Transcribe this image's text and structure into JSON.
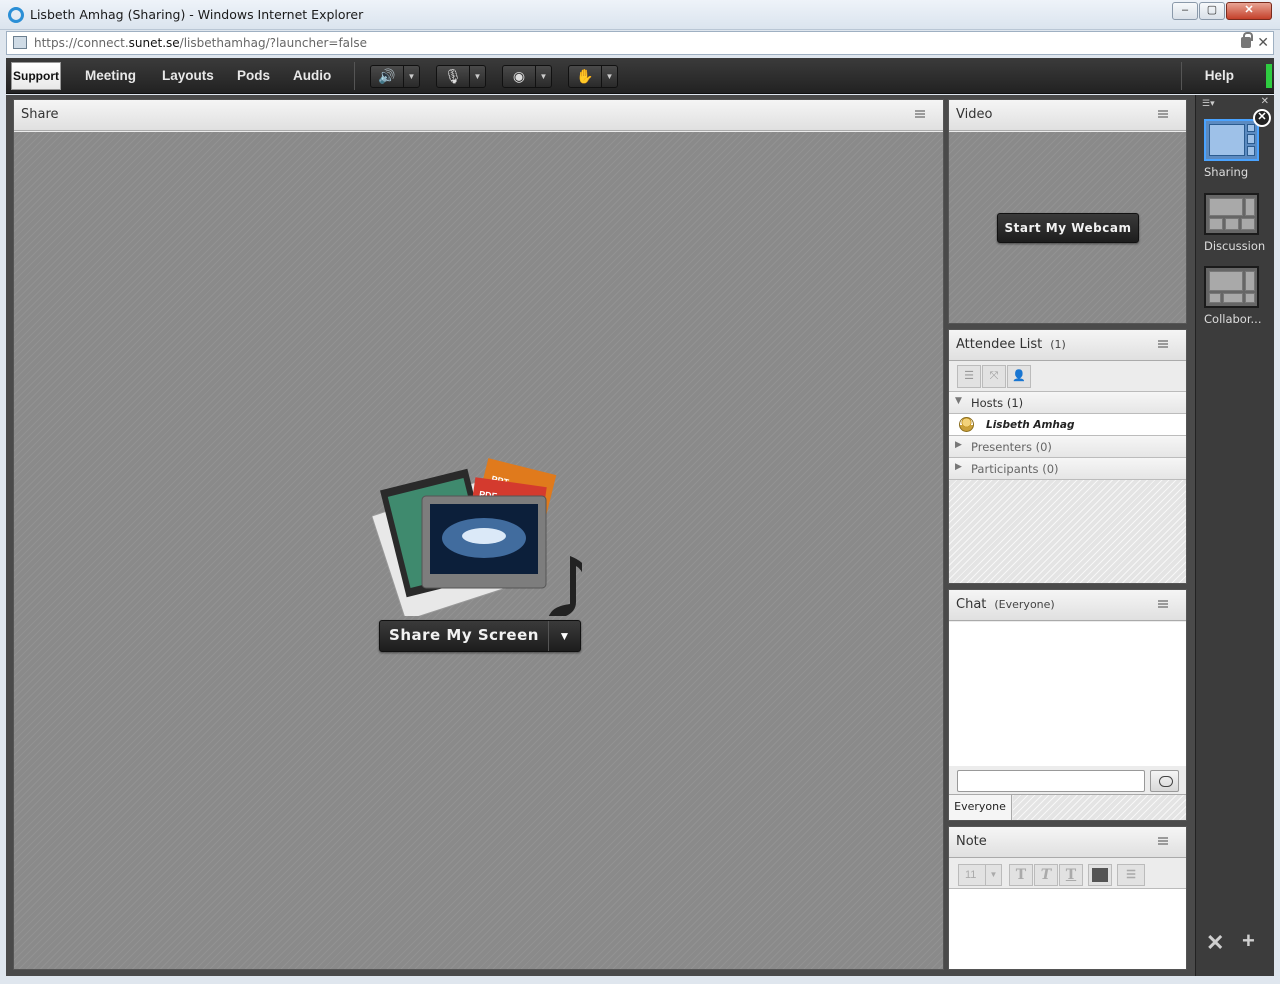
{
  "window": {
    "title": "Lisbeth Amhag (Sharing) - Windows Internet Explorer",
    "controls": {
      "minimize": "–",
      "maximize": "▢",
      "close": "✕"
    }
  },
  "address_bar": {
    "url_prefix": "https://connect.",
    "url_domain": "sunet.se",
    "url_path": "/lisbethamhag/?launcher=false",
    "icons": [
      "page-icon",
      "lock-icon",
      "close-icon"
    ]
  },
  "menubar": {
    "logo": "Support",
    "menus": [
      "Meeting",
      "Layouts",
      "Pods",
      "Audio"
    ],
    "help": "Help",
    "toolbar_icons": [
      "speaker-icon",
      "microphone-icon",
      "webcam-icon",
      "raise-hand-icon"
    ],
    "speaker_active_color": "#3cd43c"
  },
  "share_pod": {
    "title": "Share",
    "button_label": "Share My Screen",
    "graphic_labels": {
      "ppt": "PPT",
      "pdf": "PDF"
    }
  },
  "video_pod": {
    "title": "Video",
    "button_label": "Start My Webcam"
  },
  "attendee_pod": {
    "title": "Attendee List",
    "count": "(1)",
    "toolbar_icons": [
      "list-view-icon",
      "breakout-icon",
      "attendee-status-icon"
    ],
    "groups": [
      {
        "label": "Hosts (1)",
        "expanded": true,
        "members": [
          "Lisbeth Amhag"
        ]
      },
      {
        "label": "Presenters (0)",
        "expanded": false
      },
      {
        "label": "Participants (0)",
        "expanded": false
      }
    ]
  },
  "chat_pod": {
    "title": "Chat",
    "scope": "(Everyone)",
    "input_value": "",
    "tab_label": "Everyone"
  },
  "note_pod": {
    "title": "Note",
    "font_size": "11",
    "format_buttons": [
      "T",
      "T",
      "T"
    ]
  },
  "layouts": {
    "items": [
      {
        "label": "Sharing",
        "selected": true
      },
      {
        "label": "Discussion",
        "selected": false
      },
      {
        "label": "Collabor...",
        "selected": false
      }
    ],
    "selected_color": "#4aa3ff"
  }
}
